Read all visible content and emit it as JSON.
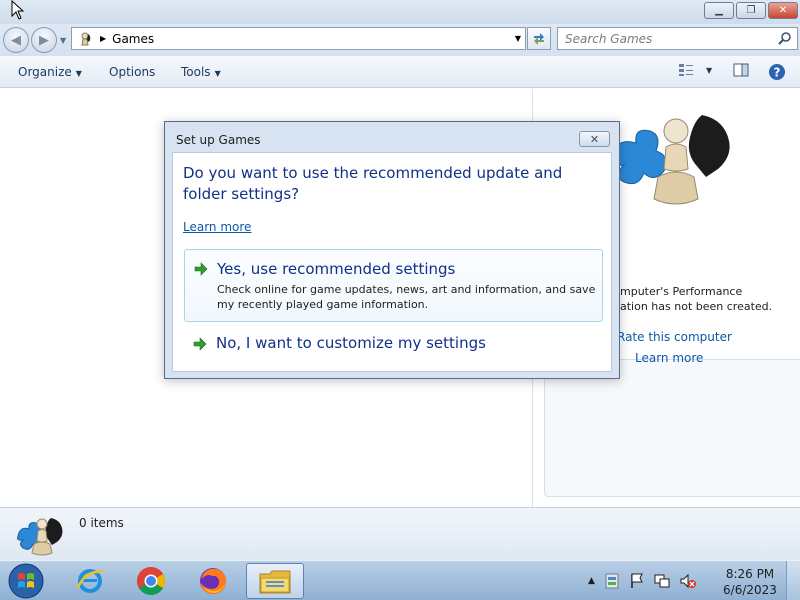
{
  "window": {
    "minimize_glyph": "▁",
    "maximize_glyph": "❐",
    "close_glyph": "✕"
  },
  "nav": {
    "back_glyph": "◀",
    "forward_glyph": "▶",
    "breadcrumb": "Games",
    "search_placeholder": "Search Games"
  },
  "commands": {
    "organize": "Organize",
    "options": "Options",
    "tools": "Tools"
  },
  "details_pane": {
    "perf_line1": "mputer's Performance",
    "perf_line2": "ation has not been created.",
    "rate_link": "Rate this computer",
    "learn_link": "Learn more"
  },
  "status": {
    "item_count": "0 items"
  },
  "dialog": {
    "title": "Set up Games",
    "close_glyph": "✕",
    "question": "Do you want to use the recommended update and folder settings?",
    "learn_more": "Learn more",
    "option_recommended": {
      "heading": "Yes, use recommended settings",
      "description": "Check online for game updates, news, art and information, and save my recently played game information."
    },
    "option_customize": {
      "heading": "No, I want to customize my settings"
    }
  },
  "taskbar": {
    "time": "8:26 PM",
    "date": "6/6/2023",
    "pinned": [
      "start-orb",
      "internet-explorer-icon",
      "chrome-icon",
      "firefox-icon",
      "file-explorer-icon"
    ]
  },
  "colors": {
    "link": "#0b5aa8",
    "heading_blue": "#11308a",
    "green_arrow": "#2f9e2f"
  }
}
